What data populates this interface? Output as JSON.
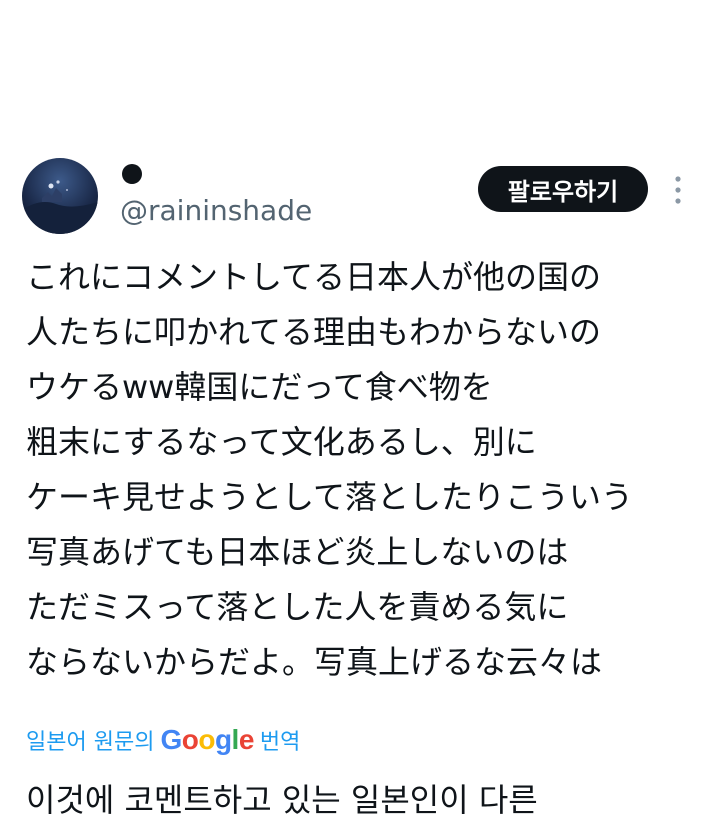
{
  "author": {
    "handle": "@raininshade"
  },
  "follow_button": {
    "label": "팔로우하기"
  },
  "tweet": {
    "lines": [
      "これにコメントしてる日本人が他の国の",
      "人たちに叩かれてる理由もわからないの",
      "ウケるww韓国にだって食べ物を",
      "粗末にするなって文化あるし、別に",
      "ケーキ見せようとして落としたりこういう",
      "写真あげても日本ほど炎上しないのは",
      "ただミスって落とした人を責める気に",
      "ならないからだよ。写真上げるな云々は"
    ]
  },
  "translation": {
    "prefix": "일본어 원문의",
    "brand": "Google",
    "suffix": "번역",
    "text": "이것에 코멘트하고 있는 일본인이 다른"
  },
  "colors": {
    "link": "#1d9bf0",
    "text": "#0f1419",
    "muted": "#536471",
    "button_bg": "#0f1419"
  },
  "icons": {
    "more": "more-vertical-icon"
  }
}
